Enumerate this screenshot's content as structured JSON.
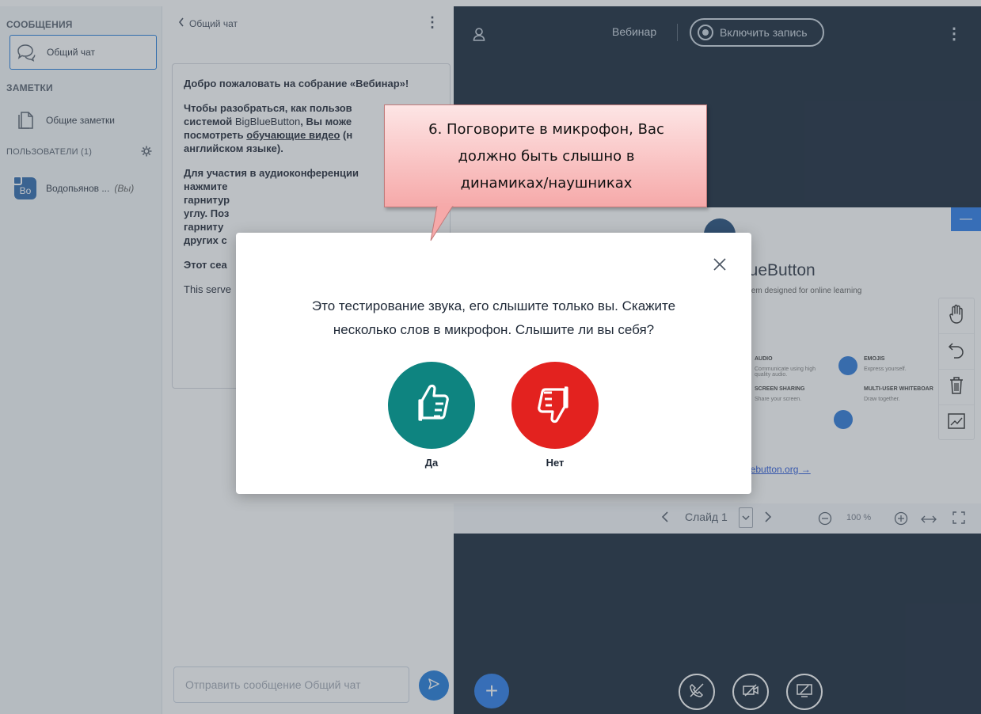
{
  "sidebar": {
    "messages_title": "СООБЩЕНИЯ",
    "public_chat": "Общий чат",
    "notes_title": "ЗАМЕТКИ",
    "shared_notes": "Общие заметки",
    "users_title": "ПОЛЬЗОВАТЕЛИ (1)",
    "user": {
      "initials": "Во",
      "name": "Водопьянов ...",
      "you": "(Вы)"
    }
  },
  "chat": {
    "title": "Общий чат",
    "welcome": {
      "p1_a": "Добро пожаловать на собрание «",
      "p1_b": "Вебинар",
      "p1_c": "»!",
      "p2_a": "Чтобы разобраться, как пользов",
      "p2_b": "системой ",
      "p2_c": "BigBlueButton",
      "p2_d": ", Вы може",
      "p2_e": "посмотреть ",
      "p2_link": "обучающие видео",
      "p2_f": " (н",
      "p2_g": "английском языке).",
      "p3_a": "Для участия в аудиоконференции",
      "p3_b": "нажмите",
      "p3_c": "гарнитур",
      "p3_d": "углу. ",
      "p3_e": "Поз",
      "p3_f": "гарниту",
      "p3_g": "других с",
      "p4": "Этот сеа",
      "p5": "This serve"
    },
    "input_placeholder": "Отправить сообщение Общий чат"
  },
  "main": {
    "title": "Вебинар",
    "record_label": "Включить запись",
    "slide": {
      "title": "lueButton",
      "subtitle": "stem designed for online learning",
      "features": [
        {
          "head": "AUDIO",
          "desc": "Communicate using high quality audio."
        },
        {
          "head": "EMOJIS",
          "desc": "Express yourself."
        },
        {
          "head": "SCREEN SHARING",
          "desc": "Share your screen."
        },
        {
          "head": "MULTI-USER WHITEBOAR",
          "desc": "Draw together."
        }
      ],
      "link": "uebutton.org →"
    },
    "slide_bar": {
      "slide_label": "Слайд 1",
      "zoom": "100 %"
    }
  },
  "modal": {
    "text_line1": "Это тестирование звука, его слышите только вы. Скажите",
    "text_line2": "несколько слов в микрофон. Слышите ли вы себя?",
    "yes_label": "Да",
    "no_label": "Нет",
    "yes_color": "#0e8480",
    "no_color": "#e3221f"
  },
  "callout": {
    "line1": "6. Поговорите в микрофон, Вас",
    "line2": "должно быть слышно в",
    "line3": "динамиках/наушниках"
  }
}
